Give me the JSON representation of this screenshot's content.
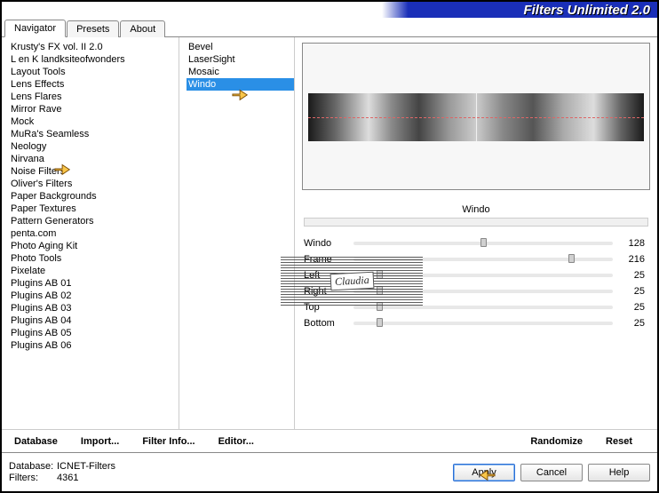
{
  "title": "Filters Unlimited 2.0",
  "tabs": [
    {
      "label": "Navigator",
      "active": true
    },
    {
      "label": "Presets",
      "active": false
    },
    {
      "label": "About",
      "active": false
    }
  ],
  "categories": [
    "Krusty's FX vol. II 2.0",
    "L en K landksiteofwonders",
    "Layout Tools",
    "Lens Effects",
    "Lens Flares",
    "Mirror Rave",
    "Mock",
    "MuRa's Seamless",
    "Neology",
    "Nirvana",
    "Noise Filters",
    "Oliver's Filters",
    "Paper Backgrounds",
    "Paper Textures",
    "Pattern Generators",
    "penta.com",
    "Photo Aging Kit",
    "Photo Tools",
    "Pixelate",
    "Plugins AB 01",
    "Plugins AB 02",
    "Plugins AB 03",
    "Plugins AB 04",
    "Plugins AB 05",
    "Plugins AB 06"
  ],
  "filters": [
    {
      "label": "Bevel",
      "selected": false
    },
    {
      "label": "LaserSight",
      "selected": false
    },
    {
      "label": "Mosaic",
      "selected": false
    },
    {
      "label": "Windo",
      "selected": true
    }
  ],
  "selected_filter_name": "Windo",
  "params": [
    {
      "name": "Windo",
      "value": 128,
      "pct": 50
    },
    {
      "name": "Frame",
      "value": 216,
      "pct": 84
    },
    {
      "name": "Left",
      "value": 25,
      "pct": 10
    },
    {
      "name": "Right",
      "value": 25,
      "pct": 10
    },
    {
      "name": "Top",
      "value": 25,
      "pct": 10
    },
    {
      "name": "Bottom",
      "value": 25,
      "pct": 10
    }
  ],
  "toolbar": {
    "database": "Database",
    "import": "Import...",
    "filter_info": "Filter Info...",
    "editor": "Editor...",
    "randomize": "Randomize",
    "reset": "Reset"
  },
  "footer": {
    "db_label": "Database:",
    "db_value": "ICNET-Filters",
    "flt_label": "Filters:",
    "flt_value": "4361",
    "apply": "Apply",
    "cancel": "Cancel",
    "help": "Help"
  },
  "watermark": "Claudia"
}
